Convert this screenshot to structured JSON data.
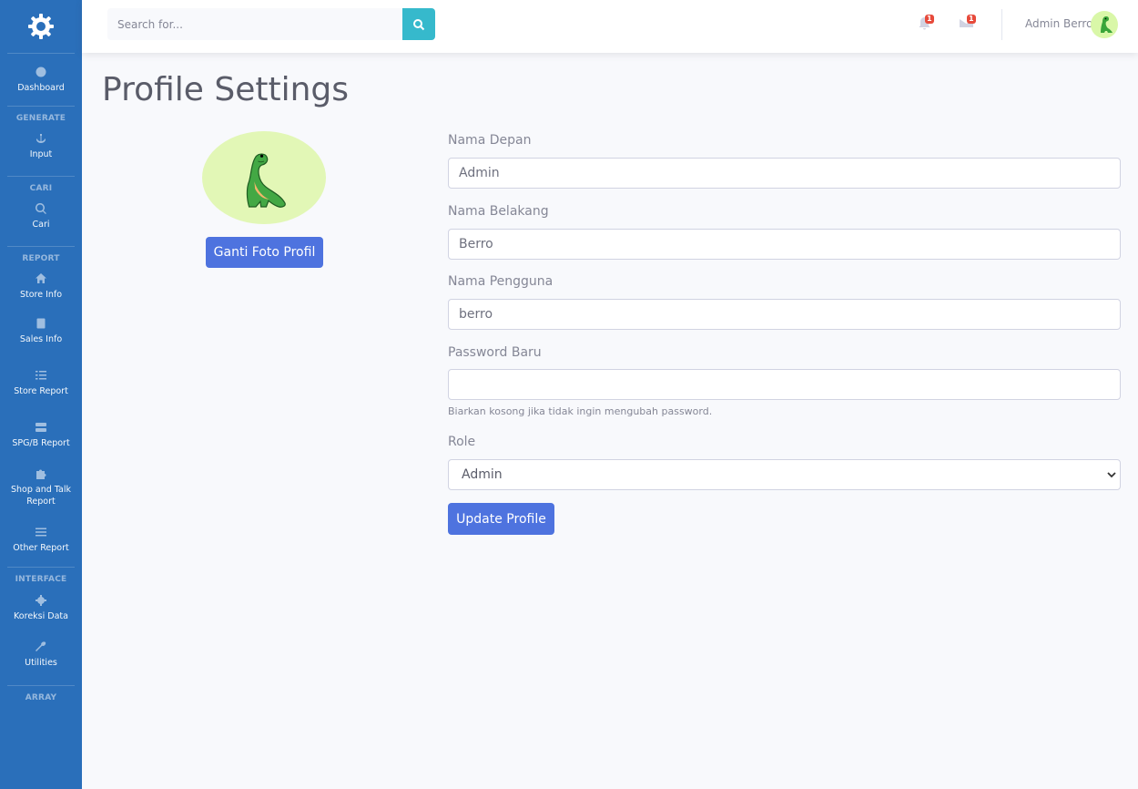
{
  "sidebar": {
    "sections": {
      "generate": "GENERATE",
      "cari": "CARI",
      "report": "REPORT",
      "interface": "INTERFACE",
      "array": "ARRAY"
    },
    "items": {
      "dashboard": "Dashboard",
      "input": "Input",
      "cari": "Cari",
      "store_info": "Store Info",
      "sales_info": "Sales Info",
      "store_report": "Store Report",
      "spg_report": "SPG/B Report",
      "shop_talk_report": "Shop and Talk Report",
      "other_report": "Other Report",
      "koreksi_data": "Koreksi Data",
      "utilities": "Utilities"
    }
  },
  "topbar": {
    "search_placeholder": "Search for...",
    "alerts_count": "1",
    "messages_count": "1",
    "user_name": "Admin Berro"
  },
  "main": {
    "title": "Profile Settings",
    "change_photo_label": "Ganti Foto Profil",
    "fields": {
      "first_name_label": "Nama Depan",
      "first_name_value": "Admin",
      "last_name_label": "Nama Belakang",
      "last_name_value": "Berro",
      "username_label": "Nama Pengguna",
      "username_value": "berro",
      "password_label": "Password Baru",
      "password_help": "Biarkan kosong jika tidak ingin mengubah password.",
      "role_label": "Role",
      "role_value": "Admin"
    },
    "update_label": "Update Profile"
  },
  "colors": {
    "sidebar": "#2a6fba",
    "primary": "#4e73df",
    "info": "#36b9cc",
    "danger": "#e74a3b",
    "avatar_bg": "#e2f7b6"
  }
}
